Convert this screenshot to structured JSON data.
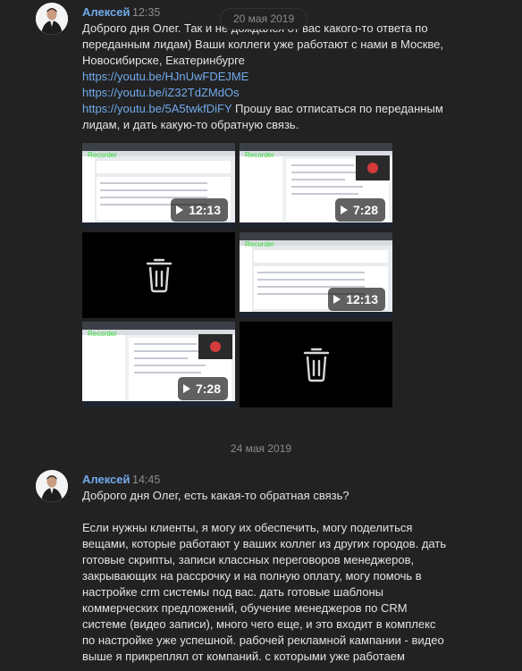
{
  "date_pill_1": "20 мая 2019",
  "date_sep_2": "24 мая 2019",
  "colors": {
    "background": "#222222",
    "author": "#71aaeb",
    "link": "#71aaeb",
    "text": "#e1e3e6",
    "muted": "#8a8c8f"
  },
  "message_1": {
    "author": "Алексей",
    "time": "12:35",
    "lines": [
      "Доброго дня Олег. Так и не дождался от вас какого-то ответа по",
      "переданным лидам) Ваши коллеги уже работают с нами в Москве,",
      "Новосибирске, Екатеринбурге"
    ],
    "link_1": "https://youtu.be/HJnUwFDEJME",
    "link_2": "https://youtu.be/iZ32TdZMdOs",
    "link_3": "https://youtu.be/5A5twkfDiFY",
    "after_link_3": " Прошу вас отписаться по переданным",
    "last_line": "лидам, и дать какую-то обратную связь.",
    "attachments": [
      {
        "type": "video",
        "duration": "12:13"
      },
      {
        "type": "video",
        "duration": "7:28"
      },
      {
        "type": "deleted",
        "icon": "trash-icon"
      },
      {
        "type": "video",
        "duration": "12:13"
      },
      {
        "type": "video",
        "duration": "7:28"
      },
      {
        "type": "deleted",
        "icon": "trash-icon"
      }
    ]
  },
  "message_2": {
    "author": "Алексей",
    "time": "14:45",
    "line_1": "Доброго дня Олег, есть какая-то обратная связь?",
    "paragraph": [
      "Если нужны клиенты, я могу их обеспечить, могу поделиться",
      "вещами, которые работают у ваших коллег из других городов. дать",
      "готовые скрипты, записи классных переговоров менеджеров,",
      "закрывающих на рассрочку и на полную оплату, могу помочь в",
      "настройке crm системы под вас. дать готовые шаблоны",
      "коммерческих предложений, обучение менеджеров по CRM",
      "системе (видео записи), много чего еще, и это входит в комплекс",
      "по настройке уже успешной. рабочей рекламной кампании - видео",
      "выше я прикреплял от компаний. с которыми уже работаем"
    ]
  }
}
